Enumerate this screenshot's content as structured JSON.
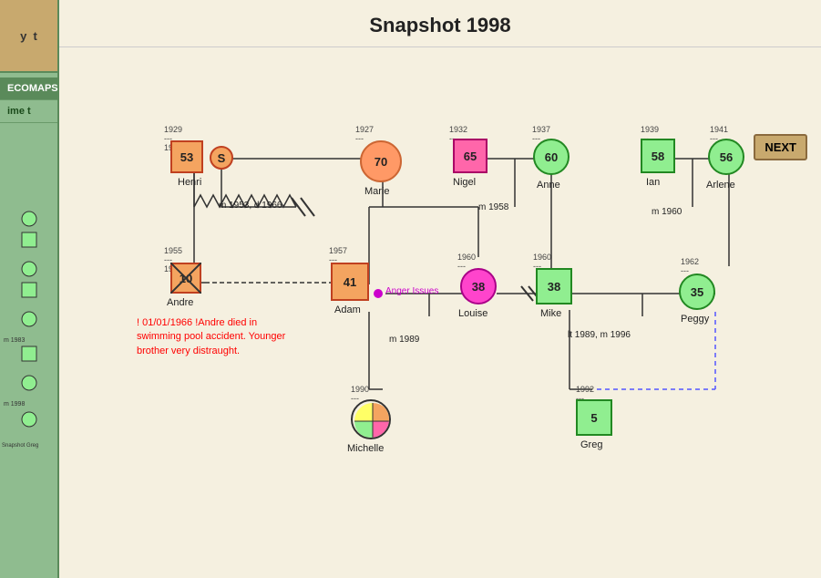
{
  "app": {
    "title": "Snapshot 1998",
    "next_label": "NEXT"
  },
  "sidebar": {
    "items": [
      {
        "label": "ECOMAPS",
        "active": true
      },
      {
        "label": "ime t",
        "active": false
      }
    ]
  },
  "people": {
    "henri": {
      "name": "Henri",
      "age": 53,
      "birth": "1929",
      "death": "1982",
      "color": "#f4a460",
      "shape": "square"
    },
    "s": {
      "name": "S",
      "age": null,
      "color": "#f4a460",
      "shape": "circle"
    },
    "marie": {
      "name": "Marie",
      "age": 70,
      "birth": "1927",
      "color": "#ff9966",
      "shape": "circle"
    },
    "nigel": {
      "name": "Nigel",
      "age": 65,
      "birth": "1932",
      "color": "#ff66aa",
      "shape": "square"
    },
    "anne": {
      "name": "Anne",
      "age": 60,
      "birth": "1937",
      "color": "#90ee90",
      "shape": "circle"
    },
    "ian": {
      "name": "Ian",
      "age": 58,
      "birth": "1939",
      "color": "#90ee90",
      "shape": "square"
    },
    "arlene": {
      "name": "Arlene",
      "age": 56,
      "birth": "1941",
      "color": "#90ee90",
      "shape": "circle"
    },
    "andre": {
      "name": "Andre",
      "age": 10,
      "birth": "1955",
      "death": "1966",
      "color": "#f4a460",
      "shape": "square"
    },
    "adam": {
      "name": "Adam",
      "age": 41,
      "birth": "1957",
      "color": "#f4a460",
      "shape": "square"
    },
    "louise": {
      "name": "Louise",
      "age": 38,
      "birth": "1960",
      "color": "#ff66aa",
      "shape": "circle"
    },
    "mike": {
      "name": "Mike",
      "age": 38,
      "birth": "1960",
      "color": "#90ee90",
      "shape": "square"
    },
    "peggy": {
      "name": "Peggy",
      "age": 35,
      "birth": "1962",
      "color": "#90ee90",
      "shape": "circle"
    },
    "michelle": {
      "name": "Michelle",
      "birth": "1990",
      "color": "pie",
      "shape": "circle"
    },
    "greg": {
      "name": "Greg",
      "age": 5,
      "birth": "1992",
      "color": "#90ee90",
      "shape": "square"
    }
  },
  "marriages": [
    {
      "label": "m 1953, d 1966"
    },
    {
      "label": "m 1958"
    },
    {
      "label": "m 1960"
    },
    {
      "label": "m 1989"
    },
    {
      "label": "lt 1989, m 1996"
    }
  ],
  "note": {
    "text": "! 01/01/1966 !Andre died in swimming pool accident. Younger brother very distraught."
  },
  "anger_issues_label": "Anger Issues"
}
